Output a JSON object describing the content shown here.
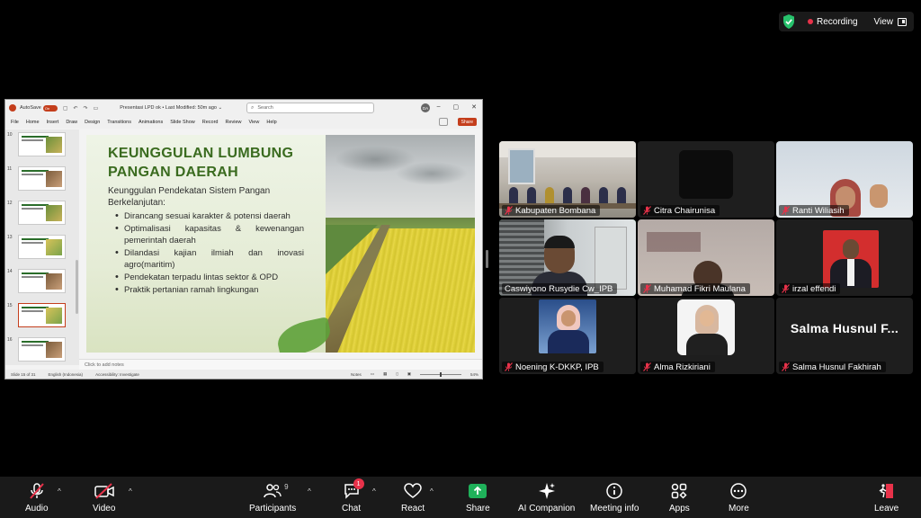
{
  "status_bar": {
    "recording_label": "Recording",
    "view_label": "View",
    "colors": {
      "shield": "#27c26c",
      "recording_dot": "#e8324a"
    }
  },
  "powerpoint": {
    "autosave_label": "AutoSave",
    "autosave_state": "On",
    "document_title": "Presentasi LPD ok • Last Modified: 50m ago ⌄",
    "search_placeholder": "Search",
    "user_initials": "DA",
    "menu": [
      "File",
      "Home",
      "Insert",
      "Draw",
      "Design",
      "Transitions",
      "Animations",
      "Slide Show",
      "Record",
      "Review",
      "View",
      "Help"
    ],
    "share_label": "Share",
    "thumbnail_numbers": [
      "10",
      "11",
      "12",
      "13",
      "14",
      "15",
      "16"
    ],
    "active_slide": "15",
    "slide": {
      "title": "KEUNGGULAN LUMBUNG PANGAN DAERAH",
      "intro": "Keunggulan Pendekatan Sistem Pangan Berkelanjutan:",
      "bullets": [
        "Dirancang sesuai karakter & potensi daerah",
        "Optimalisasi kapasitas & kewenangan pemerintah daerah",
        "Dilandasi kajian ilmiah dan inovasi agro(maritim)",
        "Pendekatan terpadu lintas sektor & OPD",
        "Praktik pertanian ramah lingkungan"
      ]
    },
    "notes_placeholder": "Click to add notes",
    "statusbar": {
      "slide_counter": "Slide 15 of 31",
      "language": "English (Indonesia)",
      "accessibility": "Accessibility: Investigate",
      "notes_btn": "Notes",
      "zoom": "54%"
    }
  },
  "gallery": {
    "participants": [
      {
        "name": "Kabupaten Bombana",
        "muted": true,
        "active": false
      },
      {
        "name": "Citra Chairunisa",
        "muted": true,
        "active": false
      },
      {
        "name": "Ranti Wiliasih",
        "muted": true,
        "active": false
      },
      {
        "name": "Caswiyono Rusydie Cw_IPB",
        "muted": false,
        "active": true
      },
      {
        "name": "Muhamad Fikri Maulana",
        "muted": true,
        "active": false
      },
      {
        "name": "irzal effendi",
        "muted": true,
        "active": false
      },
      {
        "name": "Noening K-DKKP, IPB",
        "muted": true,
        "active": false
      },
      {
        "name": "Alma Rizkiriani",
        "muted": true,
        "active": false
      },
      {
        "name": "Salma Husnul Fakhirah",
        "muted": true,
        "active": false
      }
    ],
    "big_name_text": "Salma Husnul F..."
  },
  "toolbar": {
    "audio": "Audio",
    "video": "Video",
    "participants": "Participants",
    "participants_count": "9",
    "chat": "Chat",
    "chat_badge": "1",
    "react": "React",
    "share": "Share",
    "ai_companion": "AI Companion",
    "meeting_info": "Meeting info",
    "apps": "Apps",
    "more": "More",
    "leave": "Leave",
    "colors": {
      "share": "#1fb15a",
      "muted": "#e8324a",
      "leave": "#e8324a"
    }
  }
}
